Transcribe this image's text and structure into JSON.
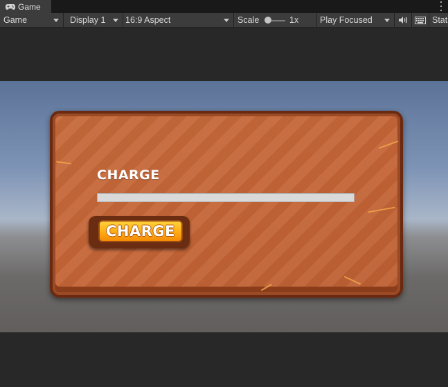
{
  "window": {
    "tab_label": "Game",
    "tab_icon": "gamepad-icon"
  },
  "toolbar": {
    "view_mode": "Game",
    "display": "Display 1",
    "aspect": "16:9 Aspect",
    "scale_label": "Scale",
    "scale_value": "1x",
    "scale_level": 0,
    "play_mode": "Play Focused",
    "mute_icon": "speaker-icon",
    "keyboard_icon": "keyboard-icon",
    "stats_label": "Stats"
  },
  "game": {
    "title": "CHARGE",
    "charge_progress": 0,
    "button_label": "CHARGE",
    "colors": {
      "panel": "#c46537",
      "panel_border": "#6a2a12",
      "button_top": "#ffd23a",
      "button_bottom": "#f58b05",
      "bar": "#d9d9d9"
    }
  }
}
